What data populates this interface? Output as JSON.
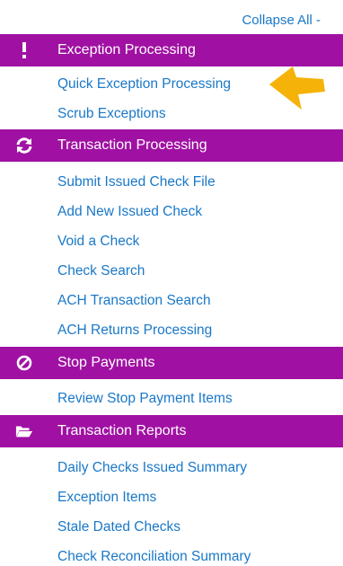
{
  "collapse_all": "Collapse All -",
  "sections": [
    {
      "title": "Exception Processing",
      "icon": "exclamation-icon",
      "items": [
        "Quick Exception Processing",
        "Scrub Exceptions"
      ]
    },
    {
      "title": "Transaction Processing",
      "icon": "refresh-icon",
      "items": [
        "Submit Issued Check File",
        "Add New Issued Check",
        "Void a Check",
        "Check Search",
        "ACH Transaction Search",
        "ACH Returns Processing"
      ]
    },
    {
      "title": "Stop Payments",
      "icon": "ban-icon",
      "items": [
        "Review Stop Payment Items"
      ]
    },
    {
      "title": "Transaction Reports",
      "icon": "folder-open-icon",
      "items": [
        "Daily Checks Issued Summary",
        "Exception Items",
        "Stale Dated Checks",
        "Check Reconciliation Summary"
      ]
    }
  ],
  "colors": {
    "header_bg": "#a011a3",
    "link": "#1a78c8",
    "arrow": "#f5b30a"
  }
}
